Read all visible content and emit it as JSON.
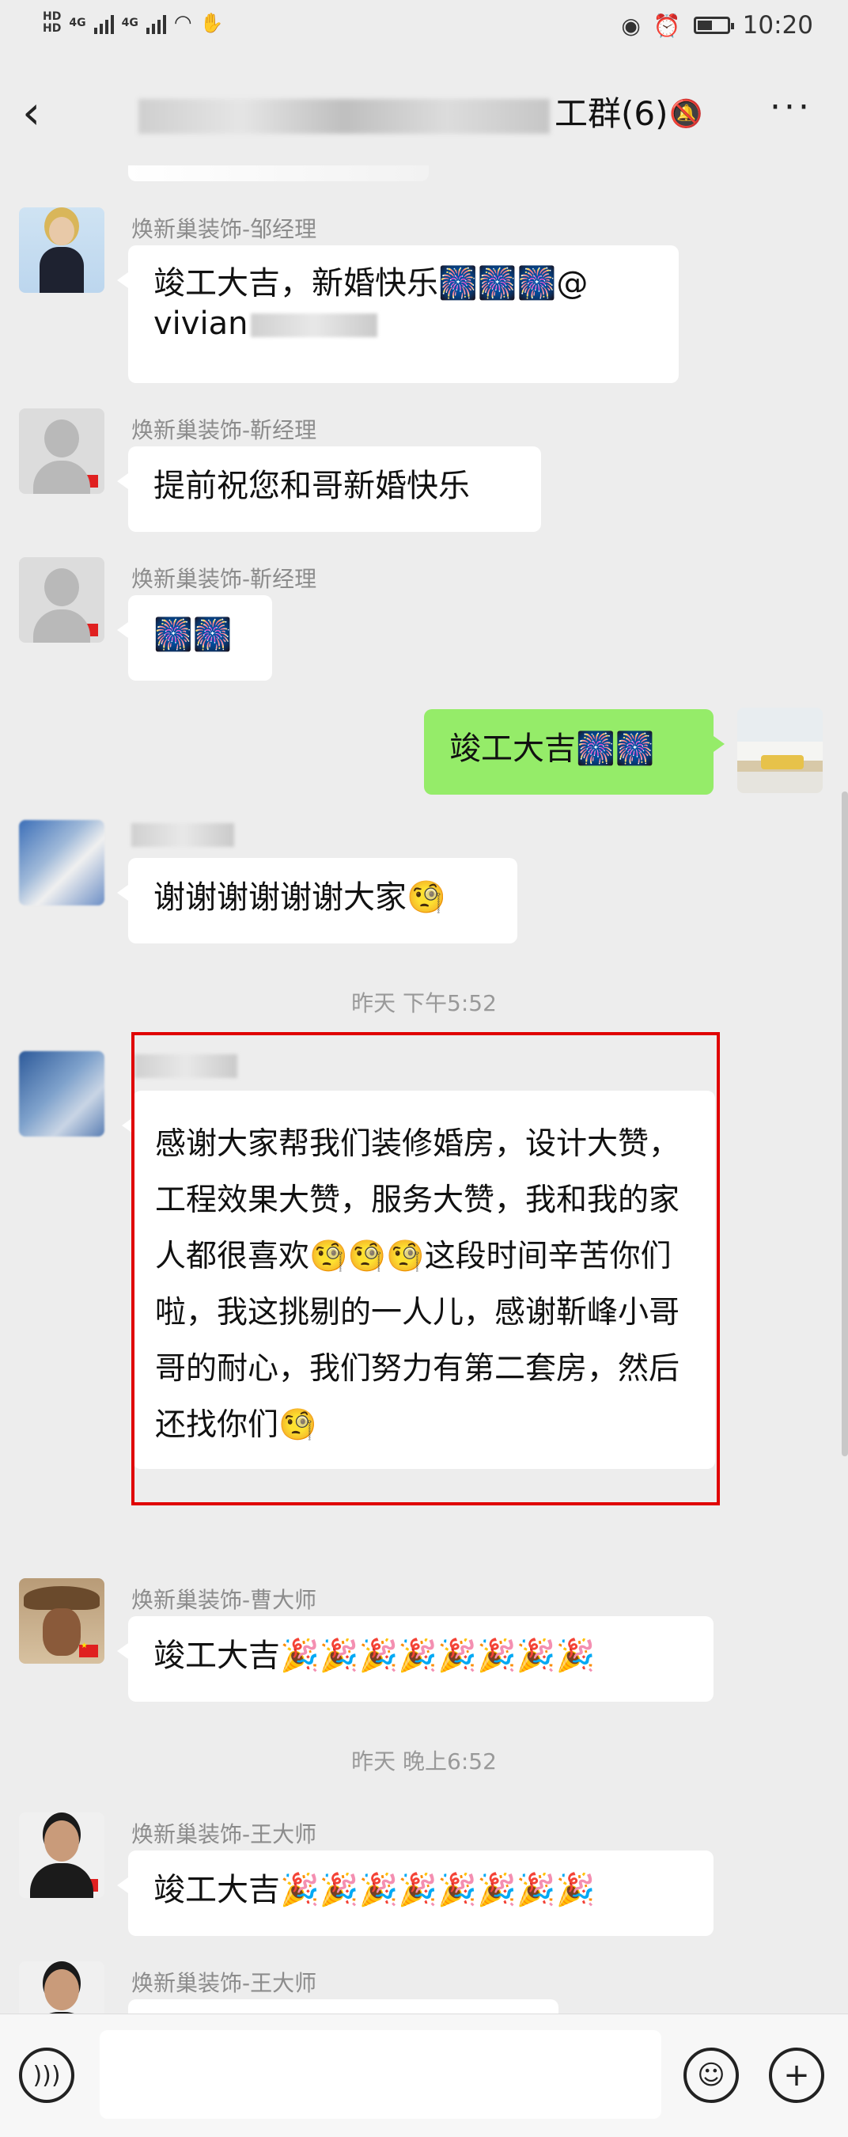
{
  "status_bar": {
    "hd_top": "HD",
    "hd_bottom": "HD",
    "net1": "4G",
    "net2": "4G",
    "wifi_icon": "wifi-icon",
    "time": "10:20"
  },
  "header": {
    "title_visible": "工群(6)",
    "back_icon": "chevron-left-icon",
    "more_icon": "more-icon"
  },
  "messages": [
    {
      "sender": "焕新巢装饰-邹经理",
      "text": "竣工大吉，新婚快乐🎆🎆🎆@",
      "text2": "vivian"
    },
    {
      "sender": "焕新巢装饰-靳经理",
      "text": "提前祝您和哥新婚快乐"
    },
    {
      "sender": "焕新巢装饰-靳经理",
      "text": "🎆🎆"
    },
    {
      "text": "竣工大吉🎆🎆"
    },
    {
      "text": "谢谢谢谢谢谢大家🧐"
    },
    {
      "timestamp": "昨天 下午5:52"
    },
    {
      "text": "感谢大家帮我们装修婚房，设计大赞，工程效果大赞，服务大赞，我和我的家人都很喜欢🧐🧐🧐这段时间辛苦你们啦，我这挑剔的一人儿，感谢靳峰小哥哥的耐心，我们努力有第二套房，然后还找你们🧐"
    },
    {
      "sender": "焕新巢装饰-曹大师",
      "text": "竣工大吉🎉🎉🎉🎉🎉🎉🎉🎉"
    },
    {
      "timestamp": "昨天 晚上6:52"
    },
    {
      "sender": "焕新巢装饰-王大师",
      "text": "竣工大吉🎉🎉🎉🎉🎉🎉🎉🎉"
    },
    {
      "sender": "焕新巢装饰-王大师"
    }
  ],
  "input_bar": {
    "voice_icon": "voice-icon",
    "emoji_icon": "emoji-icon",
    "plus_icon": "plus-icon",
    "placeholder": ""
  },
  "colors": {
    "background": "#ededed",
    "bubble_self": "#95ec69",
    "bubble_other": "#ffffff",
    "highlight": "#e00000"
  }
}
